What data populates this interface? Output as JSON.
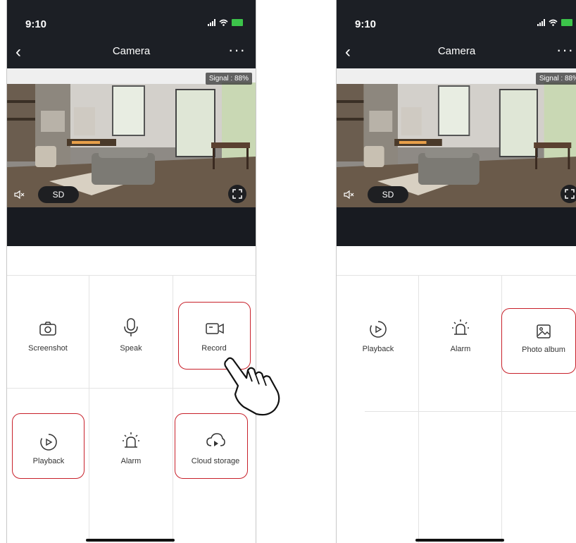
{
  "left_phone": {
    "status_time": "9:10",
    "title": "Camera",
    "signal_badge": "Signal : 88%",
    "sd_label": "SD",
    "menu": [
      {
        "label": "Screenshot",
        "icon": "camera-icon"
      },
      {
        "label": "Speak",
        "icon": "microphone-icon"
      },
      {
        "label": "Record",
        "icon": "video-record-icon"
      },
      {
        "label": "Playback",
        "icon": "playback-icon"
      },
      {
        "label": "Alarm",
        "icon": "alarm-siren-icon"
      },
      {
        "label": "Cloud storage",
        "icon": "cloud-play-icon"
      }
    ]
  },
  "right_phone": {
    "status_time": "9:10",
    "title": "Camera",
    "signal_badge": "Signal : 88%",
    "sd_label": "SD",
    "menu": [
      {
        "label": "Playback",
        "icon": "playback-icon"
      },
      {
        "label": "Alarm",
        "icon": "alarm-siren-icon"
      },
      {
        "label": "Photo album",
        "icon": "photo-icon"
      }
    ]
  },
  "colors": {
    "header_bg": "#1c1f25",
    "highlight_border": "#c8202a",
    "battery": "#3cc44a"
  }
}
